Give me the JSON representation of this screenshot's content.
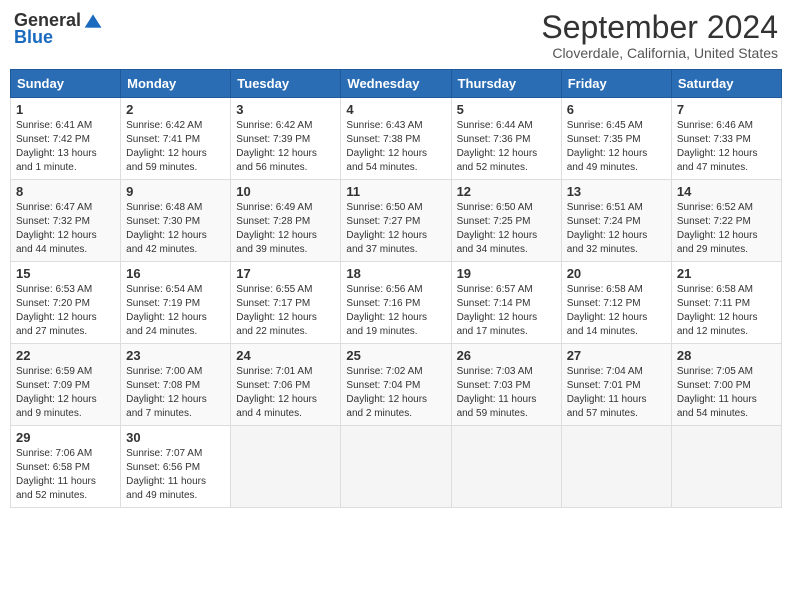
{
  "header": {
    "logo_general": "General",
    "logo_blue": "Blue",
    "month_title": "September 2024",
    "location": "Cloverdale, California, United States"
  },
  "weekdays": [
    "Sunday",
    "Monday",
    "Tuesday",
    "Wednesday",
    "Thursday",
    "Friday",
    "Saturday"
  ],
  "weeks": [
    [
      {
        "day": "1",
        "sunrise": "6:41 AM",
        "sunset": "7:42 PM",
        "daylight": "13 hours and 1 minute."
      },
      {
        "day": "2",
        "sunrise": "6:42 AM",
        "sunset": "7:41 PM",
        "daylight": "12 hours and 59 minutes."
      },
      {
        "day": "3",
        "sunrise": "6:42 AM",
        "sunset": "7:39 PM",
        "daylight": "12 hours and 56 minutes."
      },
      {
        "day": "4",
        "sunrise": "6:43 AM",
        "sunset": "7:38 PM",
        "daylight": "12 hours and 54 minutes."
      },
      {
        "day": "5",
        "sunrise": "6:44 AM",
        "sunset": "7:36 PM",
        "daylight": "12 hours and 52 minutes."
      },
      {
        "day": "6",
        "sunrise": "6:45 AM",
        "sunset": "7:35 PM",
        "daylight": "12 hours and 49 minutes."
      },
      {
        "day": "7",
        "sunrise": "6:46 AM",
        "sunset": "7:33 PM",
        "daylight": "12 hours and 47 minutes."
      }
    ],
    [
      {
        "day": "8",
        "sunrise": "6:47 AM",
        "sunset": "7:32 PM",
        "daylight": "12 hours and 44 minutes."
      },
      {
        "day": "9",
        "sunrise": "6:48 AM",
        "sunset": "7:30 PM",
        "daylight": "12 hours and 42 minutes."
      },
      {
        "day": "10",
        "sunrise": "6:49 AM",
        "sunset": "7:28 PM",
        "daylight": "12 hours and 39 minutes."
      },
      {
        "day": "11",
        "sunrise": "6:50 AM",
        "sunset": "7:27 PM",
        "daylight": "12 hours and 37 minutes."
      },
      {
        "day": "12",
        "sunrise": "6:50 AM",
        "sunset": "7:25 PM",
        "daylight": "12 hours and 34 minutes."
      },
      {
        "day": "13",
        "sunrise": "6:51 AM",
        "sunset": "7:24 PM",
        "daylight": "12 hours and 32 minutes."
      },
      {
        "day": "14",
        "sunrise": "6:52 AM",
        "sunset": "7:22 PM",
        "daylight": "12 hours and 29 minutes."
      }
    ],
    [
      {
        "day": "15",
        "sunrise": "6:53 AM",
        "sunset": "7:20 PM",
        "daylight": "12 hours and 27 minutes."
      },
      {
        "day": "16",
        "sunrise": "6:54 AM",
        "sunset": "7:19 PM",
        "daylight": "12 hours and 24 minutes."
      },
      {
        "day": "17",
        "sunrise": "6:55 AM",
        "sunset": "7:17 PM",
        "daylight": "12 hours and 22 minutes."
      },
      {
        "day": "18",
        "sunrise": "6:56 AM",
        "sunset": "7:16 PM",
        "daylight": "12 hours and 19 minutes."
      },
      {
        "day": "19",
        "sunrise": "6:57 AM",
        "sunset": "7:14 PM",
        "daylight": "12 hours and 17 minutes."
      },
      {
        "day": "20",
        "sunrise": "6:58 AM",
        "sunset": "7:12 PM",
        "daylight": "12 hours and 14 minutes."
      },
      {
        "day": "21",
        "sunrise": "6:58 AM",
        "sunset": "7:11 PM",
        "daylight": "12 hours and 12 minutes."
      }
    ],
    [
      {
        "day": "22",
        "sunrise": "6:59 AM",
        "sunset": "7:09 PM",
        "daylight": "12 hours and 9 minutes."
      },
      {
        "day": "23",
        "sunrise": "7:00 AM",
        "sunset": "7:08 PM",
        "daylight": "12 hours and 7 minutes."
      },
      {
        "day": "24",
        "sunrise": "7:01 AM",
        "sunset": "7:06 PM",
        "daylight": "12 hours and 4 minutes."
      },
      {
        "day": "25",
        "sunrise": "7:02 AM",
        "sunset": "7:04 PM",
        "daylight": "12 hours and 2 minutes."
      },
      {
        "day": "26",
        "sunrise": "7:03 AM",
        "sunset": "7:03 PM",
        "daylight": "11 hours and 59 minutes."
      },
      {
        "day": "27",
        "sunrise": "7:04 AM",
        "sunset": "7:01 PM",
        "daylight": "11 hours and 57 minutes."
      },
      {
        "day": "28",
        "sunrise": "7:05 AM",
        "sunset": "7:00 PM",
        "daylight": "11 hours and 54 minutes."
      }
    ],
    [
      {
        "day": "29",
        "sunrise": "7:06 AM",
        "sunset": "6:58 PM",
        "daylight": "11 hours and 52 minutes."
      },
      {
        "day": "30",
        "sunrise": "7:07 AM",
        "sunset": "6:56 PM",
        "daylight": "11 hours and 49 minutes."
      },
      null,
      null,
      null,
      null,
      null
    ]
  ]
}
